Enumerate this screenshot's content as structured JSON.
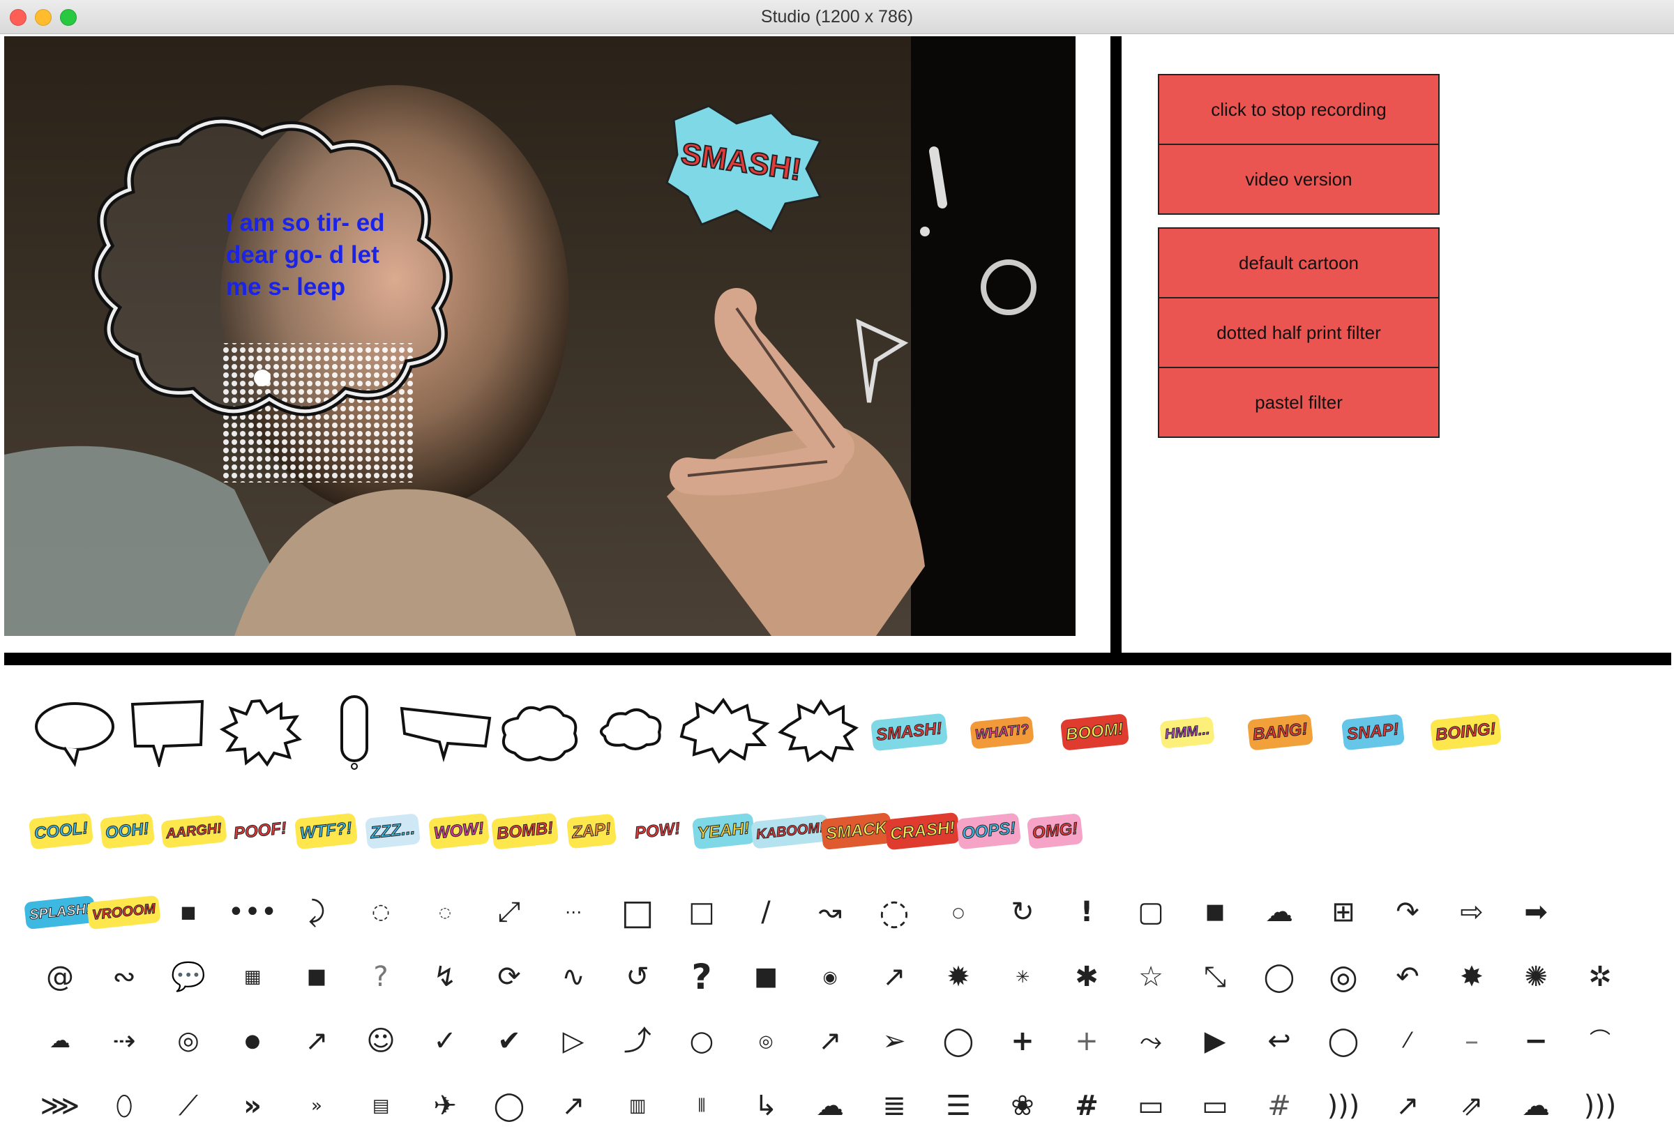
{
  "window": {
    "title": "Studio (1200 x 786)"
  },
  "video": {
    "bubble_text": "I am so tir- ed dear go- d let me s- leep",
    "overlay_sticker": "SMASH!"
  },
  "recording_panel": {
    "stop_label": "click to stop recording",
    "version_label": "video version"
  },
  "filter_panel": {
    "default_label": "default cartoon",
    "dotted_label": "dotted half print filter",
    "pastel_label": "pastel filter"
  },
  "colors": {
    "button": "#ea5551",
    "bubble_text": "#1b24e6"
  },
  "stickers_row1": [
    "SMASH!",
    "WHAT!?",
    "BOOM!",
    "HMM...",
    "BANG!",
    "SNAP!",
    "BOING!"
  ],
  "stickers_row2": [
    "COOL!",
    "OOH!",
    "AARGH!",
    "POOF!",
    "WTF?!",
    "ZZZ...",
    "WOW!",
    "BOMB!",
    "ZAP!",
    "POW!",
    "YEAH!",
    "KABOOM!",
    "SMACK",
    "CRASH!",
    "OOPS!",
    "OMG!"
  ],
  "stickers_row3": [
    "SPLASH!",
    "VROOOM"
  ]
}
